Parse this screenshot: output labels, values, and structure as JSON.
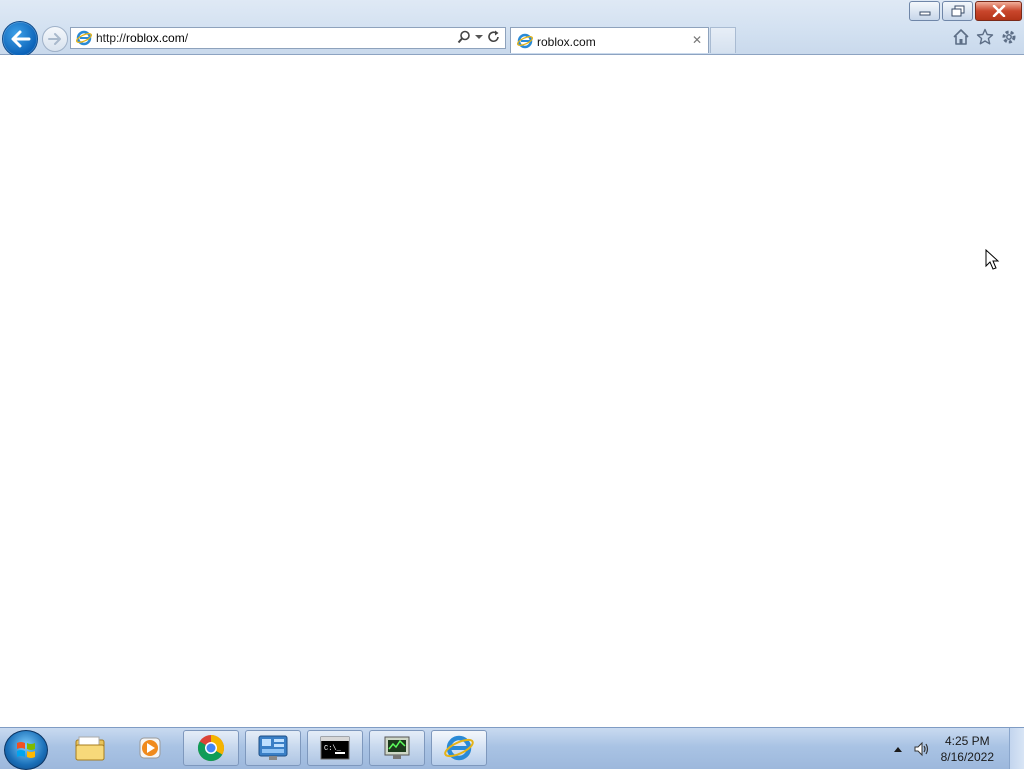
{
  "browser": {
    "address": {
      "url_prefix": "http://",
      "url_host": "roblox.com",
      "url_suffix": "/"
    },
    "tab": {
      "title": "roblox.com",
      "close_glyph": "✕"
    },
    "icons": [
      "back-arrow-icon",
      "forward-arrow-icon",
      "ie-logo-icon",
      "search-icon",
      "refresh-icon",
      "home-icon",
      "favorites-star-icon",
      "gear-icon"
    ]
  },
  "taskbar": {
    "clock": {
      "time": "4:25 PM",
      "date": "8/16/2022"
    },
    "pinned": [
      "windows-explorer",
      "windows-media-player",
      "google-chrome",
      "server-manager",
      "command-prompt",
      "network-monitor",
      "internet-explorer"
    ]
  },
  "colors": {
    "chrome_bg": "#d3e1f1",
    "taskbar_bg": "#a9c3e4",
    "back_button": "#0b62b8",
    "close_button": "#c9462c"
  }
}
